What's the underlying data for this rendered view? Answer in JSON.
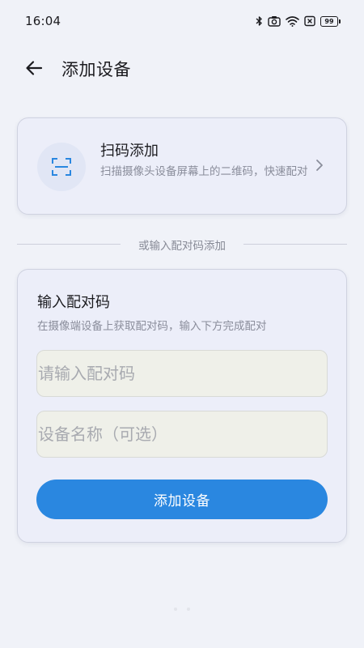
{
  "status_bar": {
    "time": "16:04",
    "battery": "99",
    "icons": [
      "bluetooth-icon",
      "camera-icon",
      "wifi-icon",
      "sim-close-icon",
      "battery-icon"
    ]
  },
  "header": {
    "back_icon": "arrow-left-icon",
    "title": "添加设备"
  },
  "scan_card": {
    "icon": "qr-scan-icon",
    "title": "扫码添加",
    "description": "扫描摄像头设备屏幕上的二维码，快速配对",
    "chevron_icon": "chevron-right-icon"
  },
  "divider": {
    "text": "或输入配对码添加"
  },
  "pair_card": {
    "title": "输入配对码",
    "description": "在摄像端设备上获取配对码，输入下方完成配对",
    "code_input": {
      "value": "",
      "placeholder": "请输入配对码"
    },
    "name_input": {
      "value": "",
      "placeholder": "设备名称（可选）"
    },
    "submit_label": "添加设备"
  },
  "colors": {
    "accent": "#2a87e0",
    "background": "#f0f2f8",
    "card": "#eceef9",
    "scan_icon": "#2a87e0"
  }
}
